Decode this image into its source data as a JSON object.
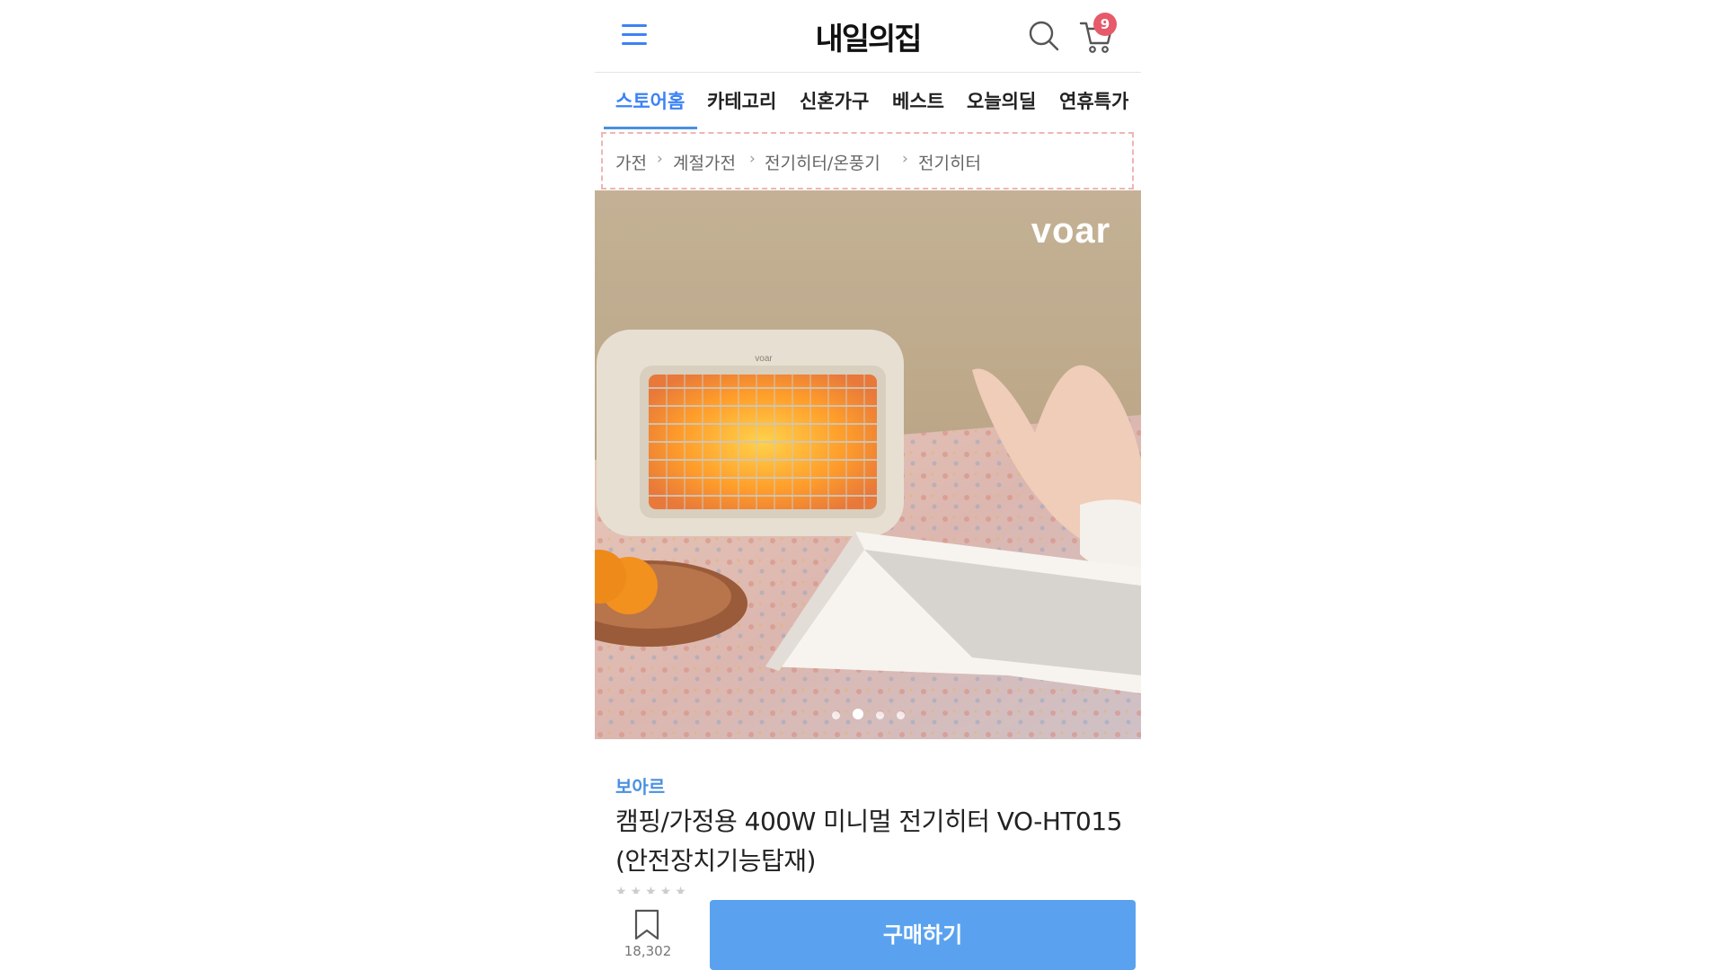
{
  "header": {
    "logo": "내일의집",
    "cart_count": "9"
  },
  "tabs": [
    {
      "label": "스토어홈",
      "active": true
    },
    {
      "label": "카테고리"
    },
    {
      "label": "신혼가구"
    },
    {
      "label": "베스트"
    },
    {
      "label": "오늘의딜"
    },
    {
      "label": "연휴특가"
    }
  ],
  "breadcrumb": [
    "가전",
    "계절가전",
    "전기히터/온풍기",
    "전기히터"
  ],
  "product": {
    "image_logo": "voar",
    "heater_logo": "voar",
    "brand": "보아르",
    "title_line1": "캠핑/가정용 400W 미니멀 전기히터 VO-HT015",
    "title_line2": "(안전장치기능탑재)",
    "image_count": 4,
    "active_image": 2
  },
  "bottom_bar": {
    "bookmark_count": "18,302",
    "buy_label": "구매하기"
  },
  "colors": {
    "accent": "#4a90e2",
    "buy_button": "#5aa2ef",
    "badge": "#e65a6a"
  }
}
